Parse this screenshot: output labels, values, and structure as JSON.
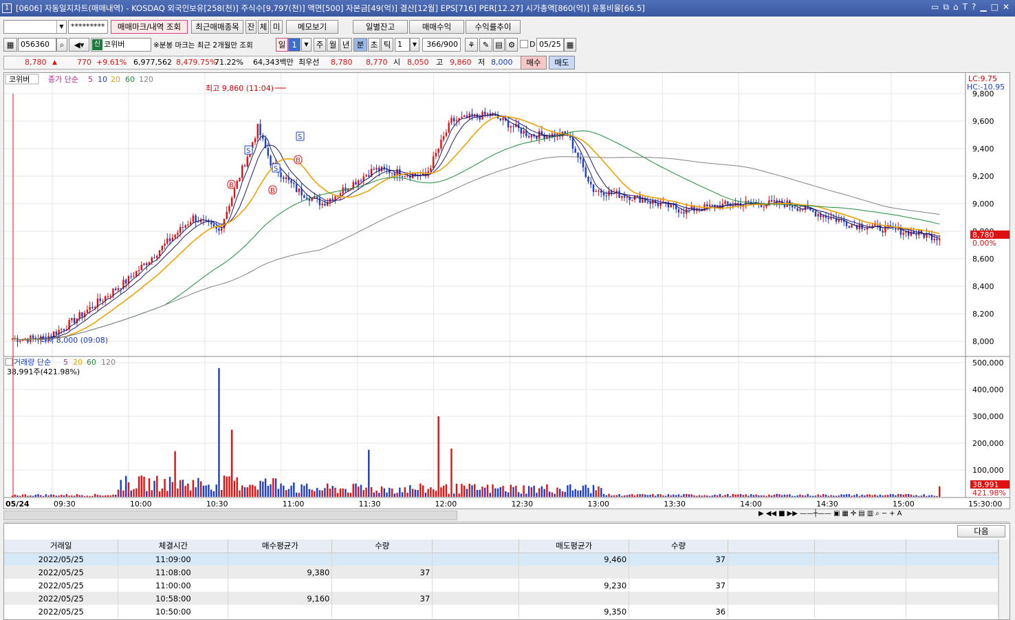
{
  "title": "[0606] 자동일지차트(매매내역) - KOSDAQ 외국인보유[258(천)] 주식수[9,797(천)] 액면[500] 자본금[49(억)] 결산[12월] EPS[716] PER[12.27] 시가총액[860(억)] 유통비율[66.5]",
  "window_num": "1",
  "toolbar": {
    "account": "",
    "password": "*********",
    "btn_trade_mark": "매매마크/내역 조회",
    "btn_recent": "최근매매종목",
    "btn_jan": "잔",
    "btn_che": "체",
    "btn_mi": "미",
    "btn_memo": "메모보기",
    "btn_daily": "일별잔고",
    "btn_profit": "매매수익",
    "btn_trend": "수익률추이"
  },
  "row2": {
    "code": "056360",
    "badge": "신",
    "name": "코위버",
    "note": "※분봉 마크는 최근 2개월만 조회",
    "p_day": "일",
    "p_num": "1",
    "p_week": "주",
    "p_month": "월",
    "p_year": "년",
    "p_min": "분",
    "p_sec": "초",
    "p_tick": "틱",
    "interval": "1",
    "count": "366/900",
    "d_label": "D",
    "date": "05/25"
  },
  "quote": {
    "price": "8,780",
    "change": "770",
    "rate": "+9.61%",
    "volume": "6,977,562",
    "vol_rate": "8,479.75%",
    "turnover": "71.22%",
    "amount": "64,343백만",
    "pref_label": "최우선",
    "ask": "8,780",
    "bid": "8,770",
    "open_label": "시",
    "open": "8,050",
    "high_label": "고",
    "high": "9,860",
    "low_label": "저",
    "low": "8,000",
    "buy_btn": "매수",
    "sell_btn": "매도"
  },
  "chart": {
    "legend_name": "코위버",
    "legend_ma": "종가 단순",
    "ma_list": [
      "5",
      "10",
      "20",
      "60",
      "120"
    ],
    "lc": "LC:9.75",
    "hc": "HC:-10.95",
    "high_label": "최고 9,860 (11:04)",
    "low_label": "최저 8,000 (09:08)",
    "price_ticks": [
      "9,800",
      "9,600",
      "9,400",
      "9,200",
      "9,000",
      "8,800",
      "8,600",
      "8,400",
      "8,200",
      "8,000"
    ],
    "current_price": "8,780",
    "current_rate": "0.00%",
    "vol_legend": "거래량 단순",
    "vol_info": "38,991주(421.98%)",
    "vol_ticks": [
      "500,000",
      "400,000",
      "300,000",
      "200,000",
      "100,000"
    ],
    "current_vol": "38,991",
    "current_vol_rate": "421.98%",
    "date_label": "05/24",
    "time_ticks": [
      "09:30",
      "10:00",
      "10:30",
      "11:00",
      "11:30",
      "12:00",
      "12:30",
      "13:00",
      "13:30",
      "14:00",
      "14:30",
      "15:00",
      "15:30:00"
    ],
    "marks": [
      "S",
      "B",
      "S",
      "B",
      "S",
      "B"
    ],
    "colors": {
      "up": "#e01010",
      "down": "#1a3cc8",
      "ma5": "#1a1a6e",
      "ma10": "#1a1a6e",
      "ma20": "#f0a000",
      "ma60": "#1e8a3a",
      "ma120": "#808080"
    }
  },
  "bottom": {
    "next_btn": "다음",
    "headers": [
      "거래일",
      "체결시간",
      "매수평균가",
      "수량",
      "",
      "매도평균가",
      "수량",
      "",
      "",
      ""
    ],
    "rows": [
      [
        "2022/05/25",
        "11:09:00",
        "",
        "",
        "",
        "9,460",
        "37",
        "",
        "",
        ""
      ],
      [
        "2022/05/25",
        "11:08:00",
        "9,380",
        "37",
        "",
        "",
        "",
        "",
        "",
        ""
      ],
      [
        "2022/05/25",
        "11:00:00",
        "",
        "",
        "",
        "9,230",
        "37",
        "",
        "",
        ""
      ],
      [
        "2022/05/25",
        "10:58:00",
        "9,160",
        "37",
        "",
        "",
        "",
        "",
        "",
        ""
      ],
      [
        "2022/05/25",
        "10:50:00",
        "",
        "",
        "",
        "9,350",
        "36",
        "",
        "",
        ""
      ]
    ]
  }
}
